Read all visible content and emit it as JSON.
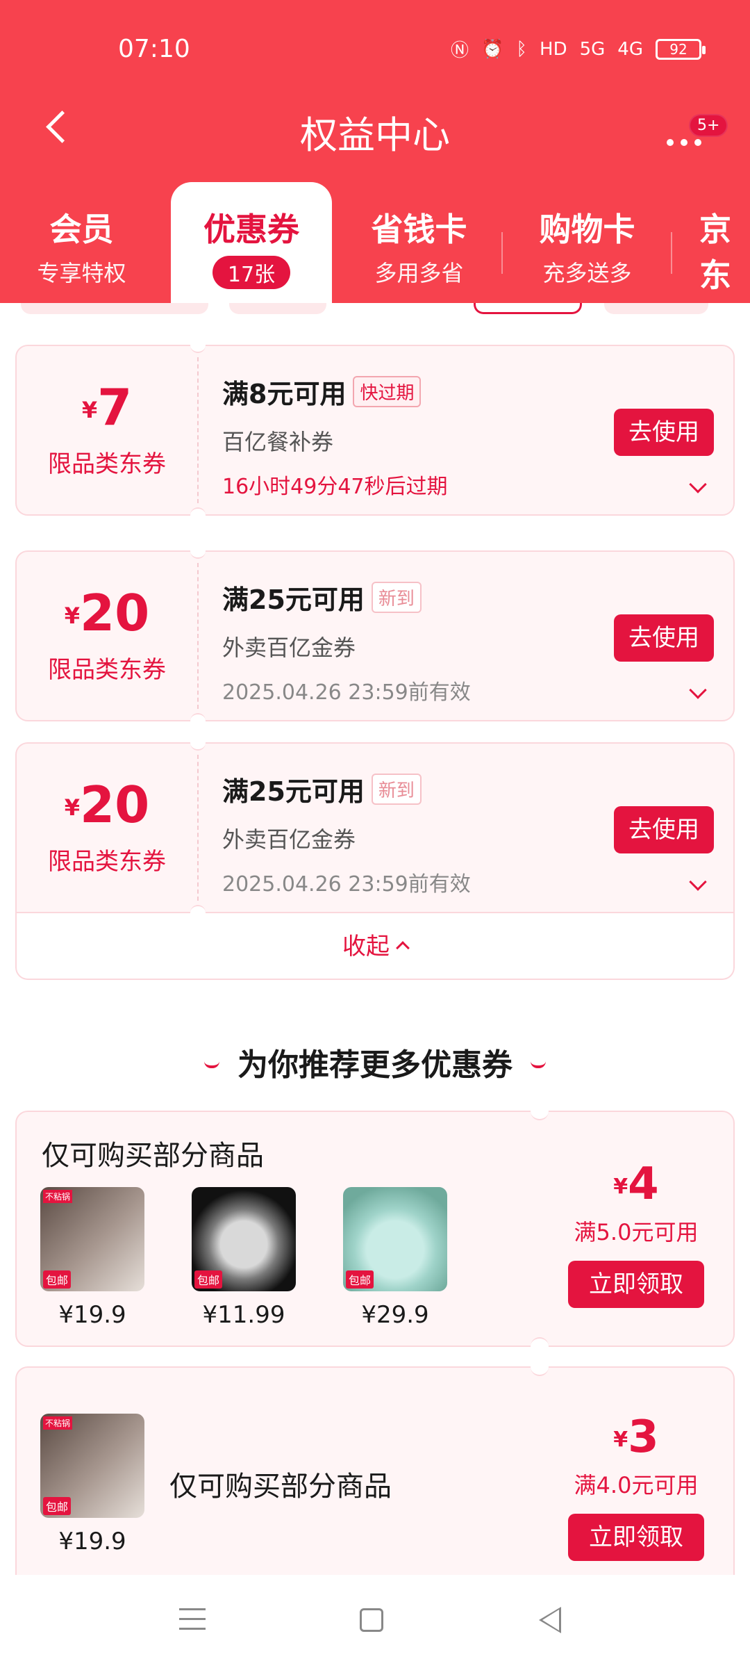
{
  "status_bar": {
    "time": "07:10",
    "icons": [
      "nfc-icon",
      "alarm-icon",
      "bluetooth-icon",
      "hd-icon",
      "5g-signal-icon",
      "4g-signal-icon"
    ],
    "hd_text": "HD",
    "net1": "5G",
    "net2": "4G",
    "battery": "92"
  },
  "header": {
    "title": "权益中心",
    "more_badge": "5+",
    "accent_color": "#f7424e"
  },
  "tabs": [
    {
      "label": "会员",
      "sub": "专享特权"
    },
    {
      "label": "优惠券",
      "badge": "17张"
    },
    {
      "label": "省钱卡",
      "sub": "多用多省"
    },
    {
      "label": "购物卡",
      "sub": "充多送多"
    },
    {
      "label": "京东",
      "sub": "¥"
    }
  ],
  "coupons": [
    {
      "currency": "¥",
      "amount": "7",
      "type": "限品类东券",
      "condition": "满8元可用",
      "tag": "快过期",
      "name": "百亿餐补券",
      "expire": "16小时49分47秒后过期",
      "button": "去使用"
    },
    {
      "currency": "¥",
      "amount": "20",
      "type": "限品类东券",
      "condition": "满25元可用",
      "tag": "新到",
      "name": "外卖百亿金券",
      "expire": "2025.04.26 23:59前有效",
      "button": "去使用"
    },
    {
      "currency": "¥",
      "amount": "20",
      "type": "限品类东券",
      "condition": "满25元可用",
      "tag": "新到",
      "name": "外卖百亿金券",
      "expire": "2025.04.26 23:59前有效",
      "button": "去使用"
    }
  ],
  "collapse_label": "收起",
  "section_title": "为你推荐更多优惠券",
  "recommend": [
    {
      "title": "仅可购买部分商品",
      "products": [
        {
          "price": "¥19.9",
          "badge": "包邮",
          "label": "不粘锅"
        },
        {
          "price": "¥11.99",
          "badge": "包邮",
          "label": ""
        },
        {
          "price": "¥29.9",
          "badge": "包邮",
          "label": ""
        }
      ],
      "currency": "¥",
      "amount": "4",
      "condition": "满5.0元可用",
      "button": "立即领取"
    },
    {
      "title": "仅可购买部分商品",
      "products": [
        {
          "price": "¥19.9",
          "badge": "包邮",
          "label": "不粘锅"
        }
      ],
      "currency": "¥",
      "amount": "3",
      "condition": "满4.0元可用",
      "button": "立即领取"
    }
  ]
}
